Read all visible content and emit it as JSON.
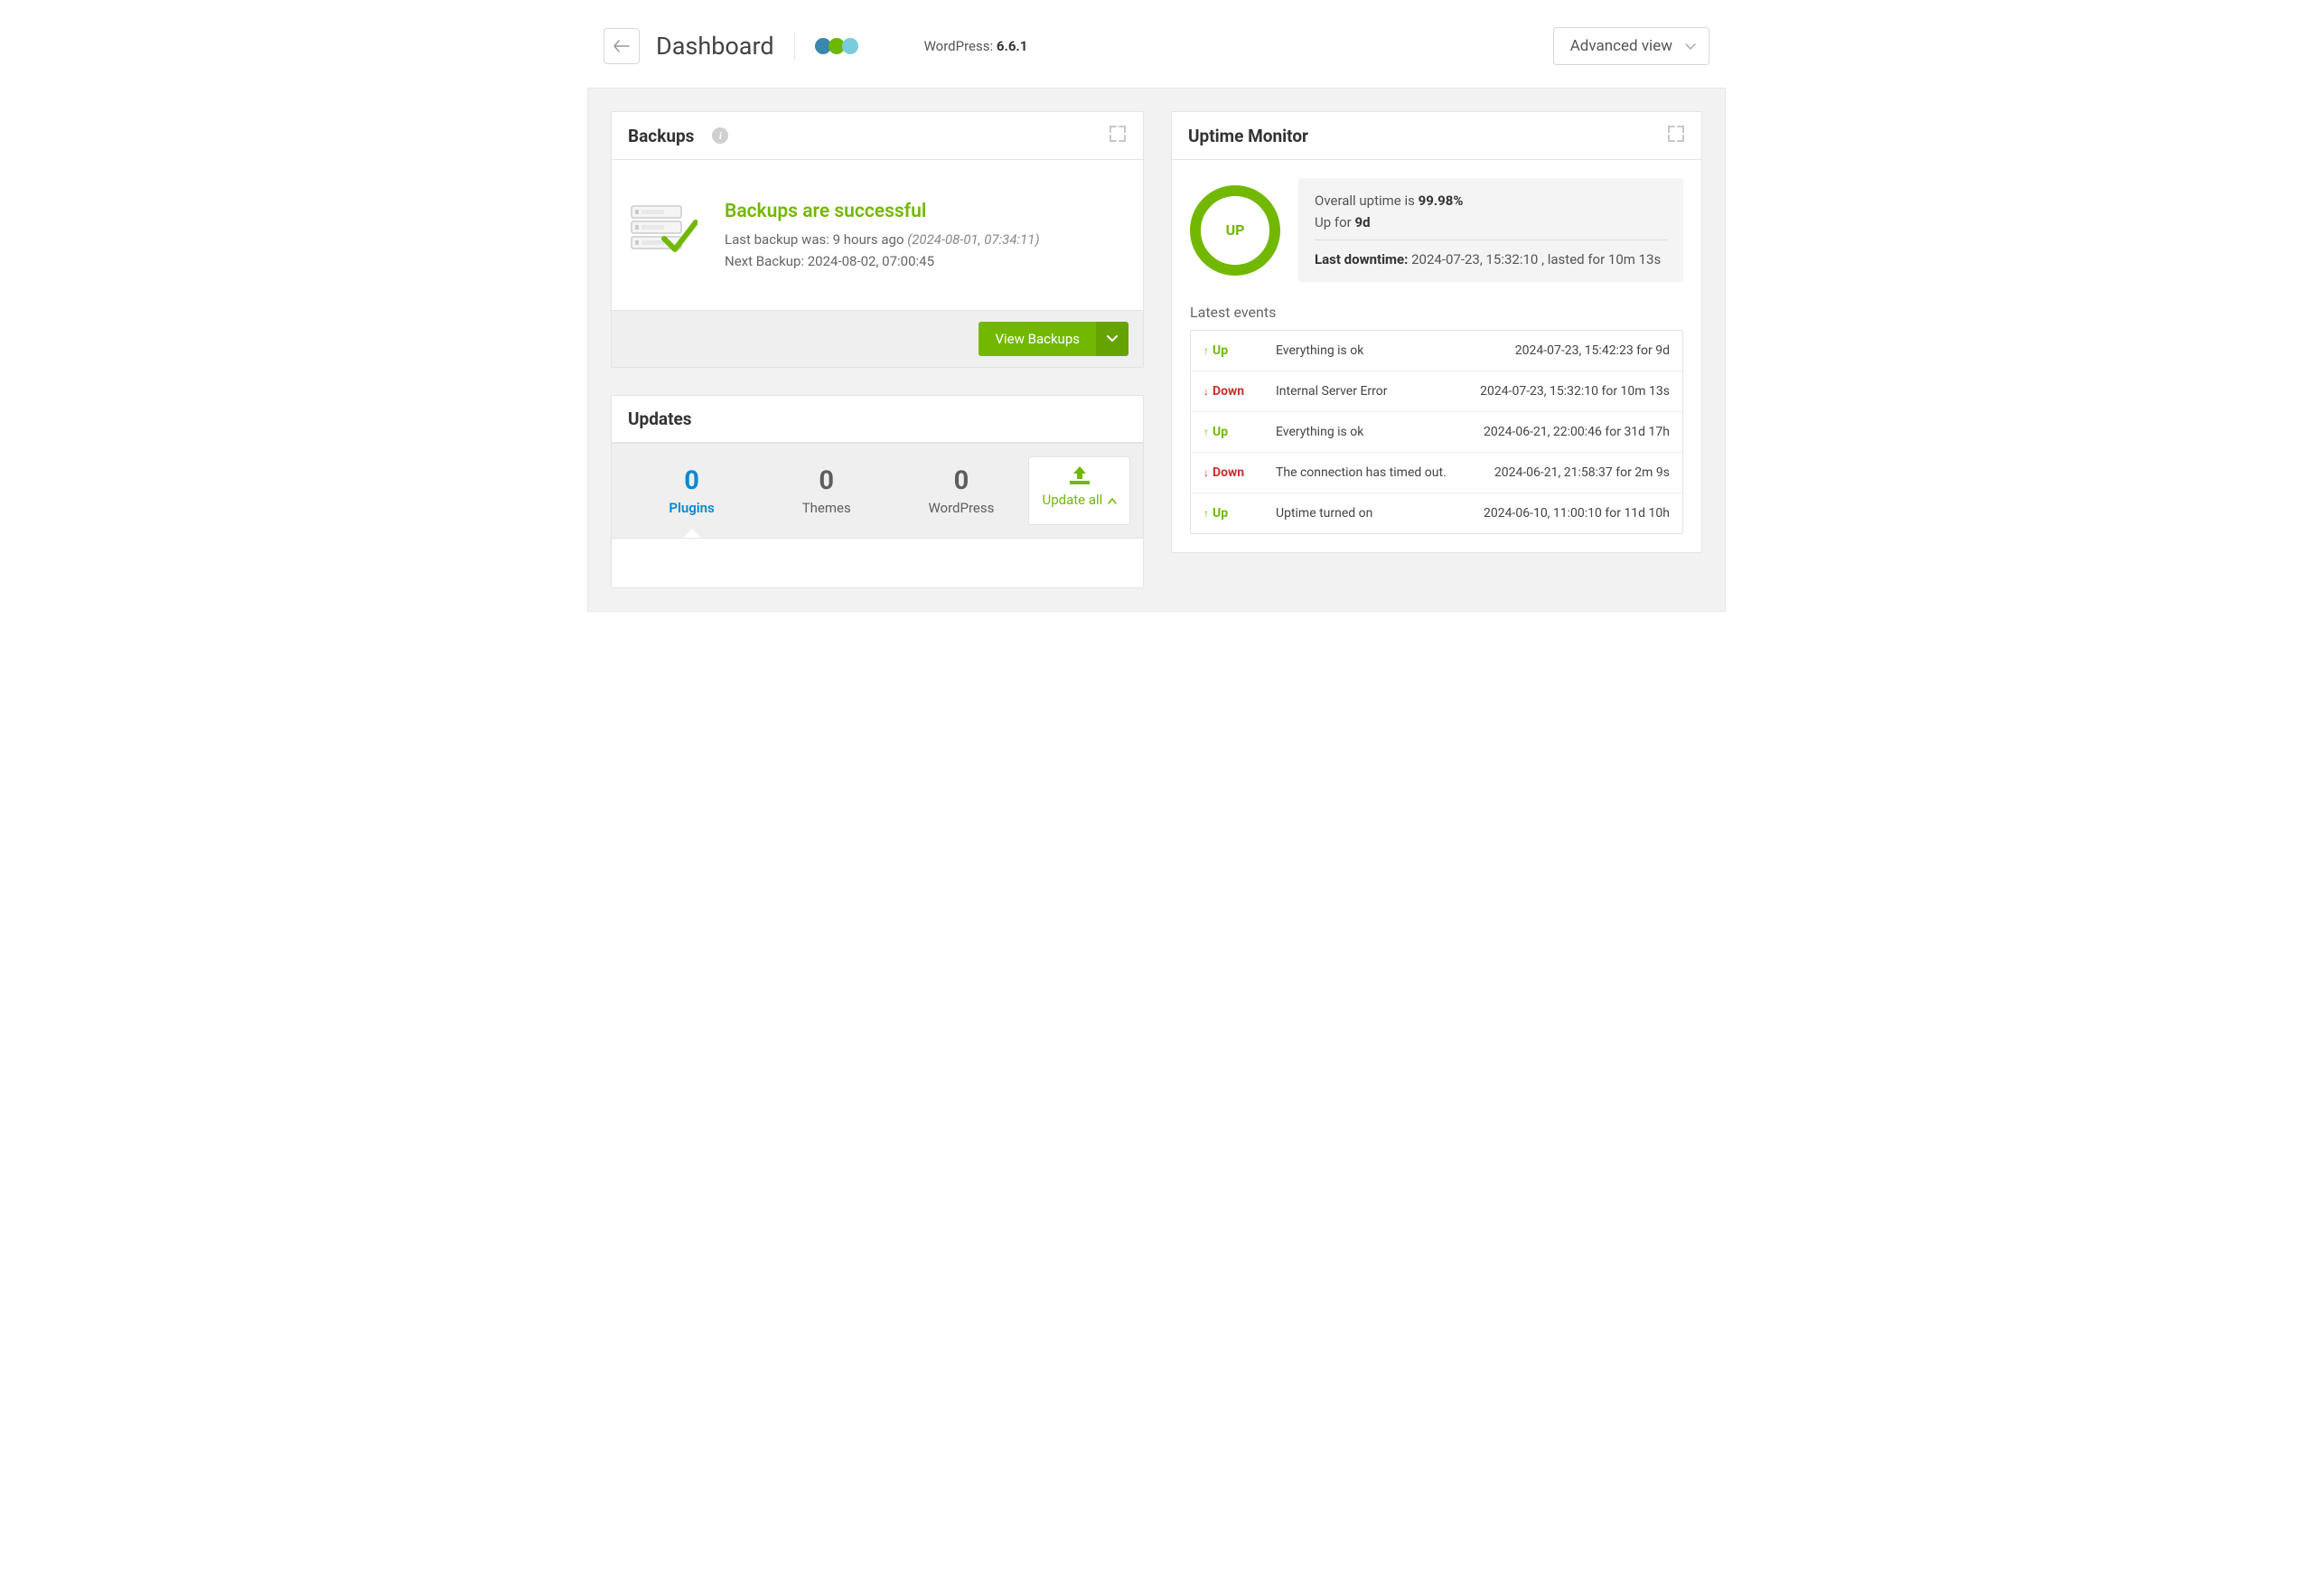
{
  "header": {
    "title": "Dashboard",
    "wp_label": "WordPress:",
    "wp_version": "6.6.1",
    "view_selector": "Advanced view"
  },
  "backups": {
    "card_title": "Backups",
    "status_title": "Backups are successful",
    "last_label": "Last backup was:",
    "last_ago": "9 hours ago",
    "last_timestamp": "(2024-08-01, 07:34:11)",
    "next_label": "Next Backup:",
    "next_timestamp": "2024-08-02, 07:00:45",
    "view_button": "View Backups"
  },
  "updates": {
    "card_title": "Updates",
    "cols": [
      {
        "count": "0",
        "label": "Plugins"
      },
      {
        "count": "0",
        "label": "Themes"
      },
      {
        "count": "0",
        "label": "WordPress"
      }
    ],
    "update_all": "Update all"
  },
  "uptime": {
    "card_title": "Uptime Monitor",
    "ring_label": "UP",
    "overall_prefix": "Overall uptime is",
    "overall_value": "99.98%",
    "upfor_prefix": "Up for",
    "upfor_value": "9d",
    "lastdown_label": "Last downtime:",
    "lastdown_time": "2024-07-23, 15:32:10 , lasted for 10m 13s",
    "latest_title": "Latest events",
    "events": [
      {
        "status": "Up",
        "msg": "Everything is ok",
        "time": "2024-07-23, 15:42:23 for 9d"
      },
      {
        "status": "Down",
        "msg": "Internal Server Error",
        "time": "2024-07-23, 15:32:10 for 10m 13s"
      },
      {
        "status": "Up",
        "msg": "Everything is ok",
        "time": "2024-06-21, 22:00:46 for 31d 17h"
      },
      {
        "status": "Down",
        "msg": "The connection has timed out.",
        "time": "2024-06-21, 21:58:37 for 2m 9s"
      },
      {
        "status": "Up",
        "msg": "Uptime turned on",
        "time": "2024-06-10, 11:00:10 for 11d 10h"
      }
    ]
  }
}
